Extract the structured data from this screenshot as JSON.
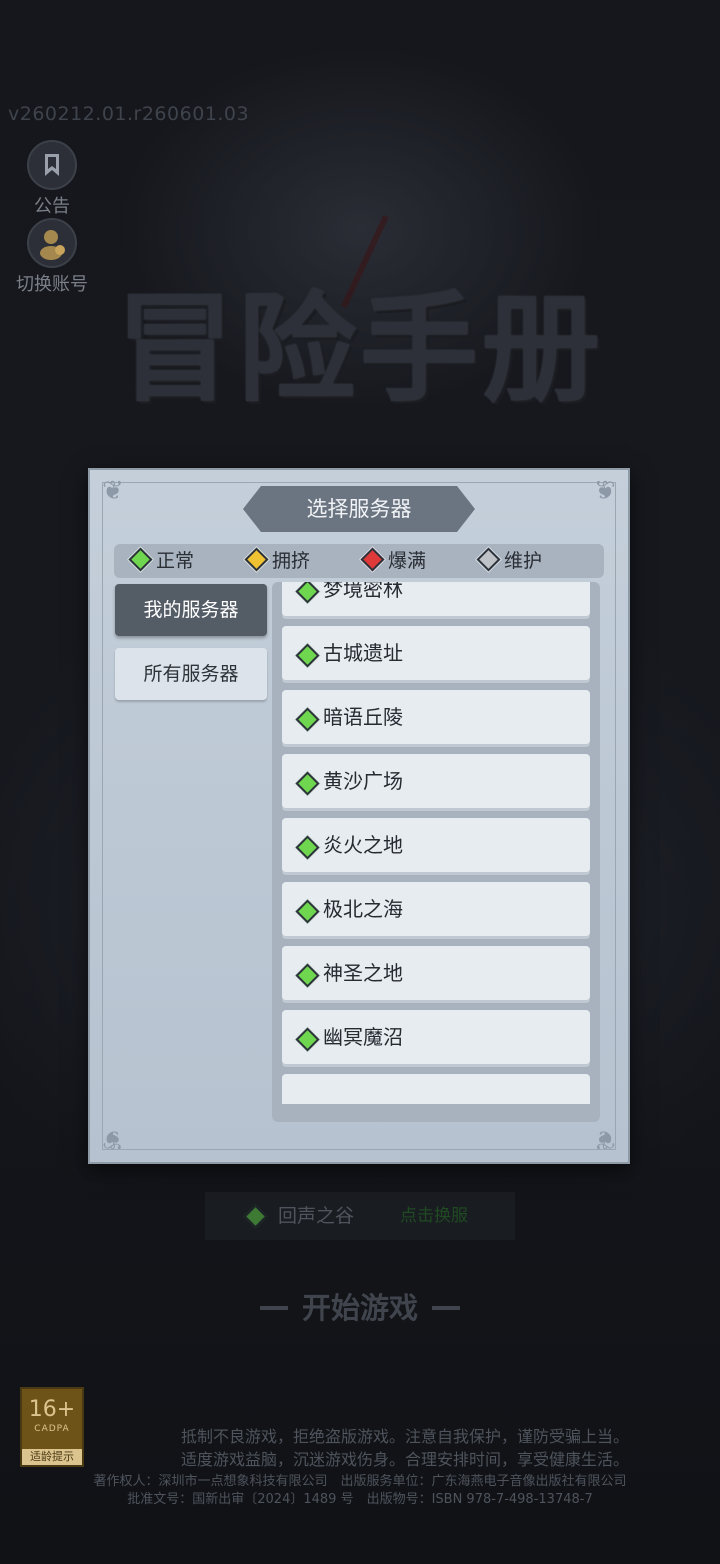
{
  "version": "v260212.01.r260601.03",
  "side_buttons": [
    {
      "label": "公告",
      "icon": "bookmark-icon"
    },
    {
      "label": "切换账号",
      "icon": "account-avatar-icon"
    }
  ],
  "logo_text": "冒险手册",
  "dialog": {
    "title": "选择服务器",
    "legend": [
      {
        "label": "正常",
        "color": "#6fd64f"
      },
      {
        "label": "拥挤",
        "color": "#f1c232"
      },
      {
        "label": "爆满",
        "color": "#e0393a"
      },
      {
        "label": "维护",
        "color": "#bfc3c8"
      }
    ],
    "tabs": [
      {
        "label": "我的服务器",
        "active": true
      },
      {
        "label": "所有服务器",
        "active": false
      }
    ],
    "servers": [
      {
        "name": "梦境密林",
        "status": "正常"
      },
      {
        "name": "古城遗址",
        "status": "正常"
      },
      {
        "name": "暗语丘陵",
        "status": "正常"
      },
      {
        "name": "黄沙广场",
        "status": "正常"
      },
      {
        "name": "炎火之地",
        "status": "正常"
      },
      {
        "name": "极北之海",
        "status": "正常"
      },
      {
        "name": "神圣之地",
        "status": "正常"
      },
      {
        "name": "幽冥魔沼",
        "status": "正常"
      },
      {
        "name": "",
        "status": "正常"
      }
    ]
  },
  "current_server": {
    "name": "回声之谷",
    "switch_label": "点击换服"
  },
  "start_button": "开始游戏",
  "age_rating": {
    "number": "16+",
    "org": "CADPA",
    "tip": "适龄提示"
  },
  "notices": [
    "抵制不良游戏，拒绝盗版游戏。注意自我保护，谨防受骗上当。",
    "适度游戏益脑，沉迷游戏伤身。合理安排时间，享受健康生活。",
    "著作权人：深圳市一点想象科技有限公司　出版服务单位：广东海燕电子音像出版社有限公司",
    "批准文号：国新出审〔2024〕1489 号　出版物号：ISBN 978-7-498-13748-7"
  ]
}
